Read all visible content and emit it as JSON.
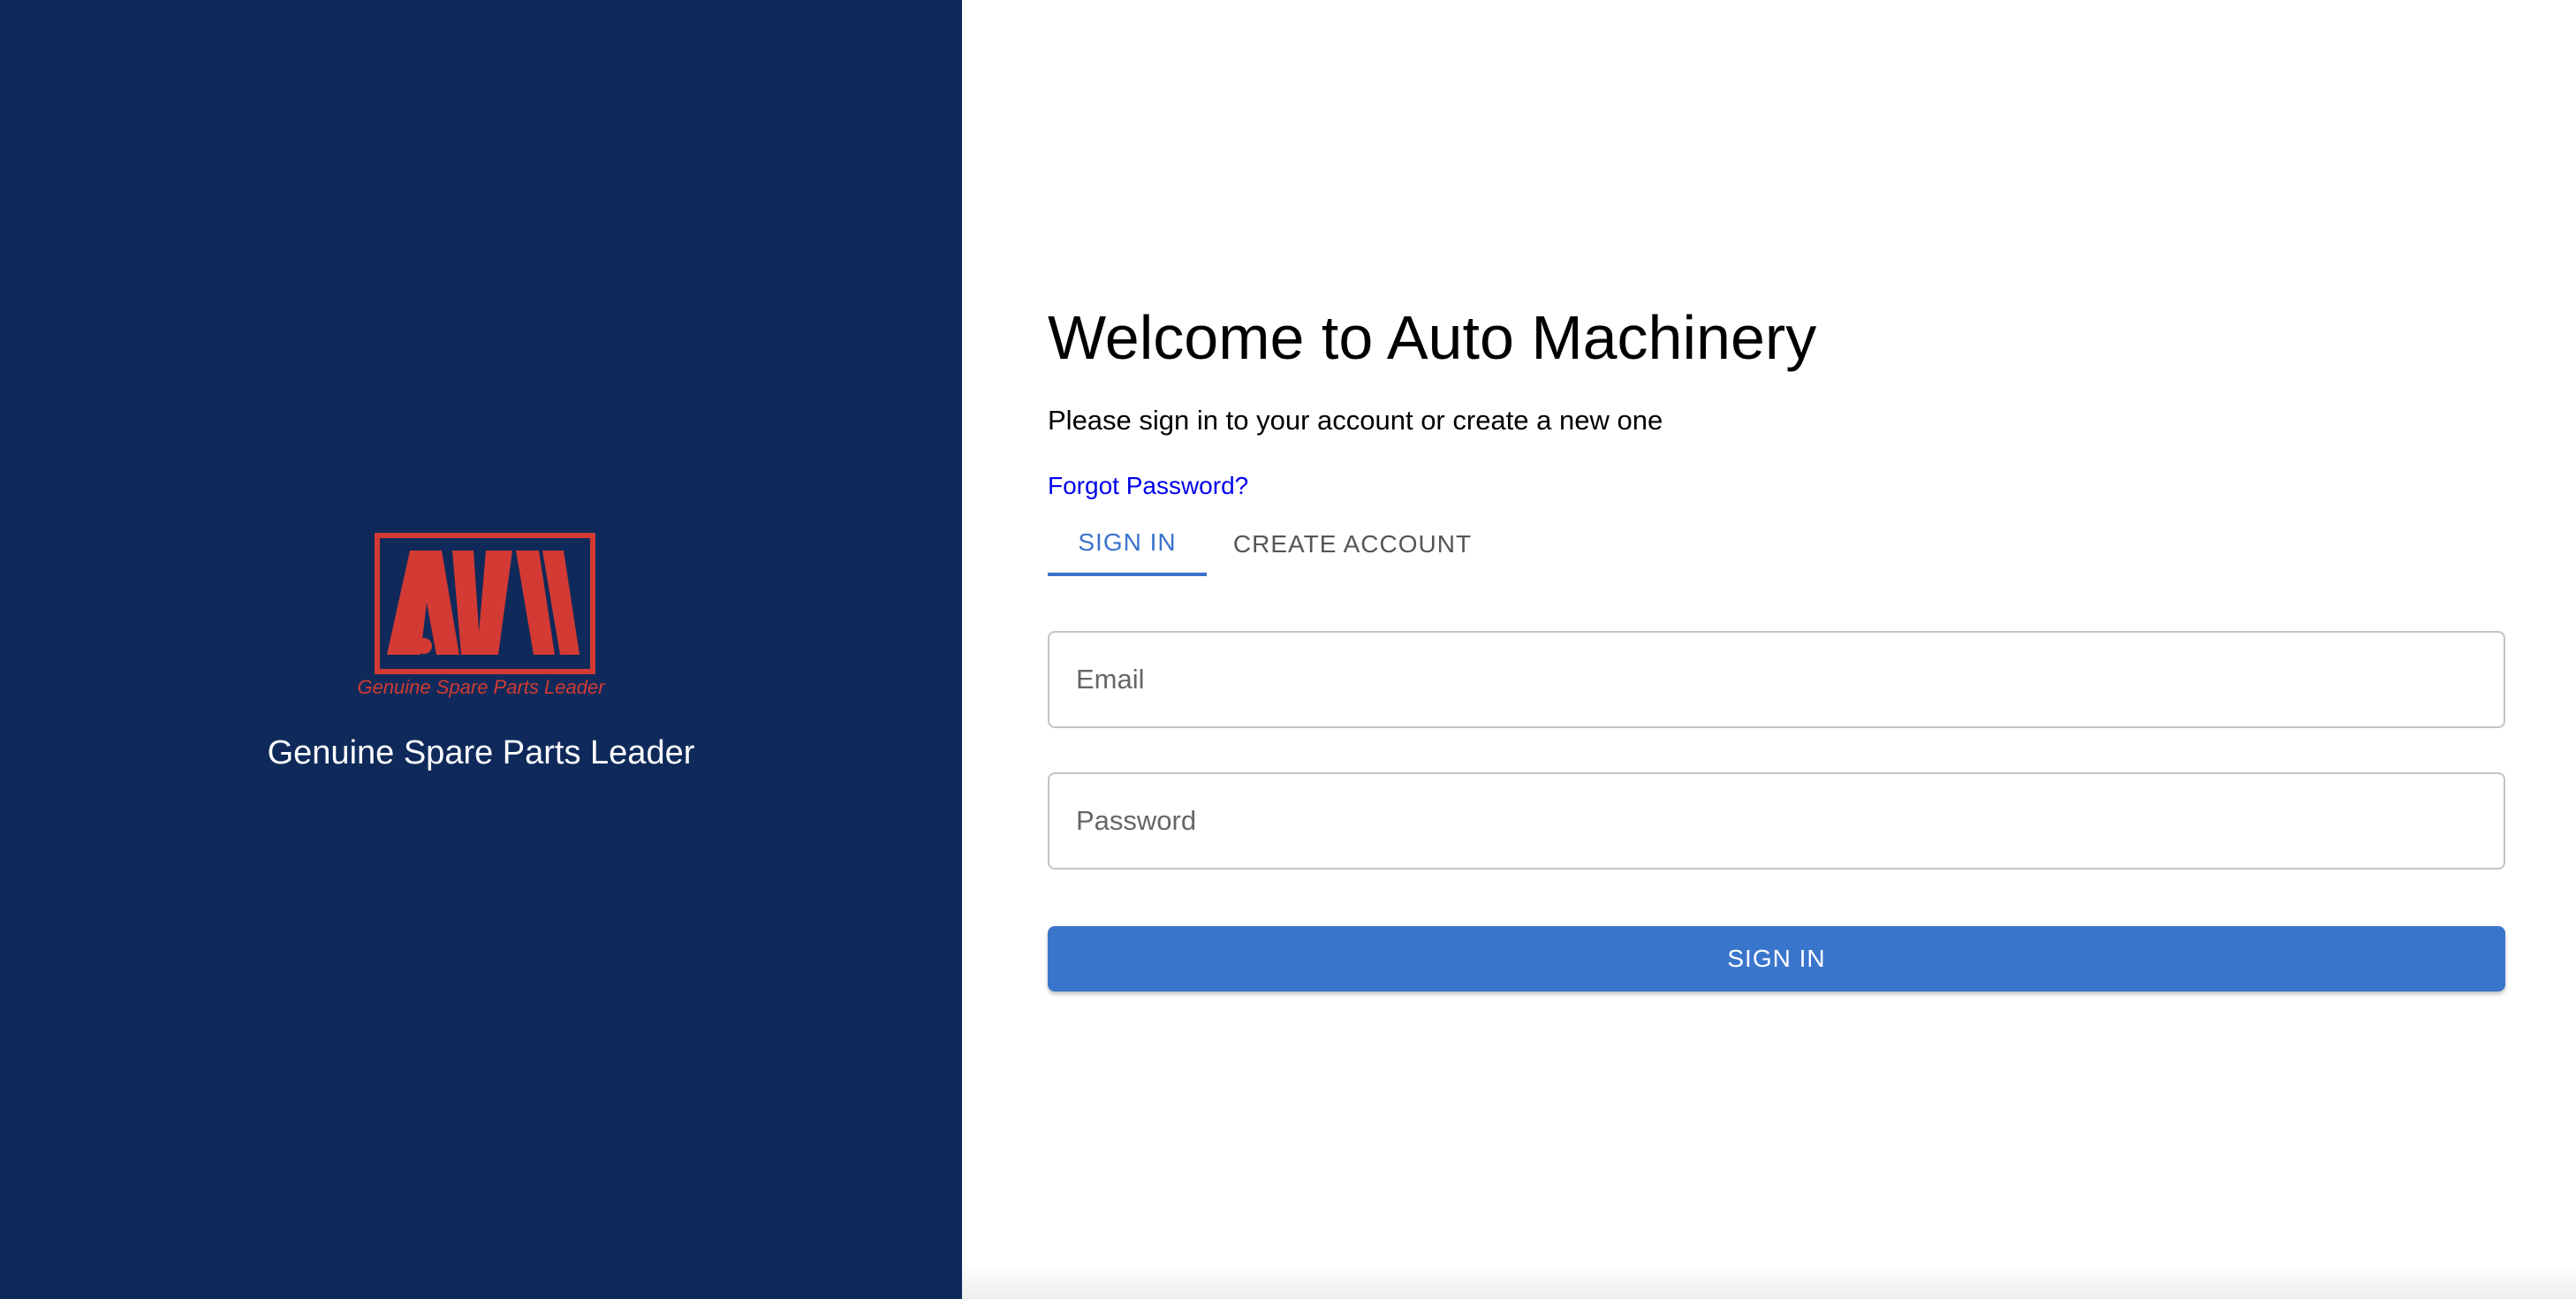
{
  "brand": {
    "logo_text": "AM",
    "logo_tagline": "Genuine Spare Parts Leader",
    "title": "Genuine Spare Parts Leader"
  },
  "login": {
    "heading": "Welcome to Auto Machinery",
    "subtitle": "Please sign in to your account or create a new one",
    "forgot_password": "Forgot Password?",
    "tabs": [
      {
        "label": "SIGN IN",
        "active": true
      },
      {
        "label": "CREATE ACCOUNT",
        "active": false
      }
    ],
    "email": {
      "placeholder": "Email",
      "value": ""
    },
    "password": {
      "placeholder": "Password",
      "value": ""
    },
    "submit_label": "SIGN IN"
  },
  "colors": {
    "left_panel_bg": "#0f2a5a",
    "logo_red": "#d23a33",
    "accent_blue": "#3a73cc",
    "link_blue": "#0000ee"
  }
}
